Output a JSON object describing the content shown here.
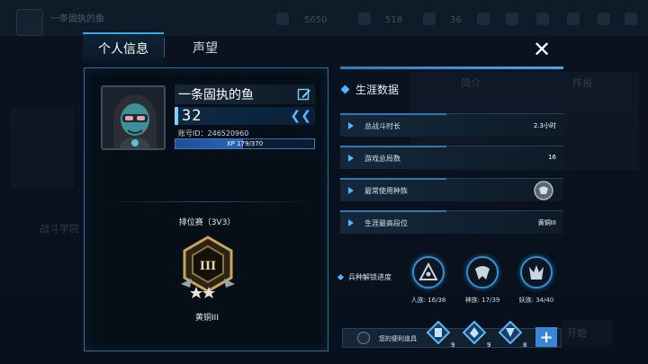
{
  "background": {
    "title": "一条固执的鱼",
    "stat_a": "5650",
    "stat_b": "518",
    "stat_c": "36",
    "faint_a": "战斗学院",
    "faint_b": "简介",
    "faint_c": "阵报",
    "faint_d": "开始"
  },
  "tabs": [
    {
      "label": "个人信息",
      "active": true
    },
    {
      "label": "声望",
      "active": false
    }
  ],
  "close_label": "✕",
  "profile": {
    "name": "一条固执的鱼",
    "level": "32",
    "account_id": "账号ID：246520960",
    "xp_text": "XP 179/370",
    "xp_progress": 0.484,
    "rank_mode": "排位赛（3V3）",
    "rank_name": "黄铜III",
    "rank_numeral": "III"
  },
  "career": {
    "title": "生涯数据",
    "stats": [
      {
        "label": "总战斗时长",
        "value": "2.3小时"
      },
      {
        "label": "游戏总局数",
        "value": "16"
      },
      {
        "label": "最常使用种族",
        "value": ""
      },
      {
        "label": "生涯最高段位",
        "value": "黄铜III"
      }
    ]
  },
  "unlock": {
    "label": "兵种解锁进度",
    "races": [
      {
        "caption": "人族: 16/38"
      },
      {
        "caption": "神族: 17/39"
      },
      {
        "caption": "妖族: 34/40"
      }
    ]
  },
  "items": {
    "label": "您的便利道具",
    "counts": [
      "9",
      "9",
      "8"
    ],
    "add_label": "+"
  },
  "colors": {
    "accent": "#4fb7ff",
    "panel_border": "#2f6f96",
    "bronze": "#c9a45a"
  }
}
